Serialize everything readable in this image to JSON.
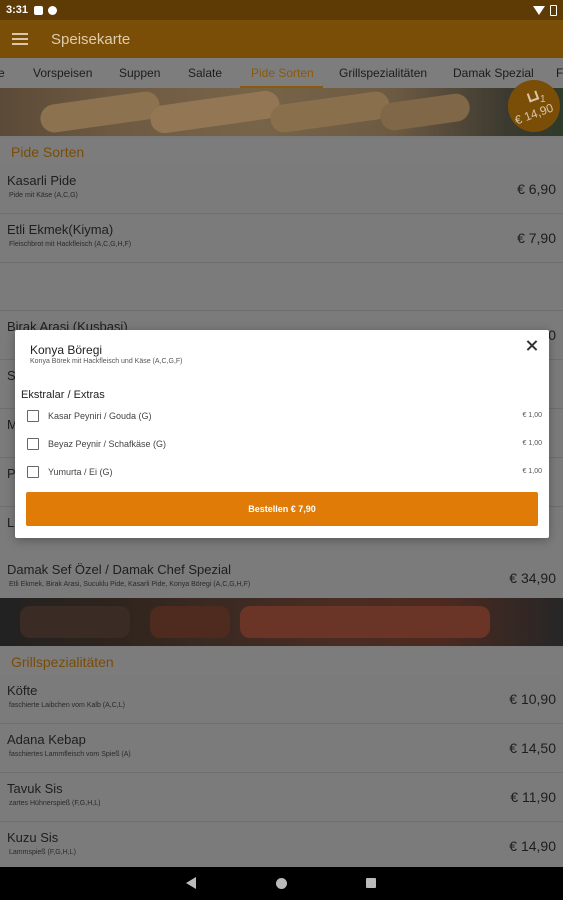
{
  "status_bar": {
    "time": "3:31"
  },
  "app_bar": {
    "title": "Speisekarte"
  },
  "tabs": [
    {
      "label": "e",
      "active": false
    },
    {
      "label": "Vorspeisen",
      "active": false
    },
    {
      "label": "Suppen",
      "active": false
    },
    {
      "label": "Salate",
      "active": false
    },
    {
      "label": "Pide Sorten",
      "active": true
    },
    {
      "label": "Grillspezialitäten",
      "active": false
    },
    {
      "label": "Damak Spezial",
      "active": false
    },
    {
      "label": "F",
      "active": false
    }
  ],
  "cart": {
    "count": "1",
    "total": "€ 14,90"
  },
  "sections": [
    {
      "title": "Pide Sorten",
      "items": [
        {
          "name": "Kasarli Pide",
          "desc": "Pide mit Käse (A,C,G)",
          "price": "€ 6,90"
        },
        {
          "name": "Etli Ekmek(Kiyma)",
          "desc": "Fleischbrot mit Hackfleisch (A,C,G,H,F)",
          "price": "€ 7,90"
        },
        {
          "name": "",
          "desc": "",
          "price": ""
        },
        {
          "name": "Birak Arasi (Kusbasi)",
          "desc": "",
          "price": "€ 7,90"
        },
        {
          "name": "S",
          "desc": "",
          "price": ""
        },
        {
          "name": "M",
          "desc": "",
          "price": ""
        },
        {
          "name": "P",
          "desc": "",
          "price": ""
        },
        {
          "name": "L",
          "desc": "",
          "price": ""
        },
        {
          "name": "Damak Sef Özel / Damak Chef Spezial",
          "desc": "Etli Ekmek, Birak Arasi, Sucuklu Pide, Kasarli Pide, Konya Böregi (A,C,G,H,F)",
          "price": "€ 34,90"
        }
      ]
    },
    {
      "title": "Grillspezialitäten",
      "items": [
        {
          "name": "Köfte",
          "desc": "faschierte Laibchen vom Kalb (A,C,L)",
          "price": "€ 10,90"
        },
        {
          "name": "Adana Kebap",
          "desc": "faschiertes Lammfleisch vom Spieß (A)",
          "price": "€ 14,50"
        },
        {
          "name": "Tavuk Sis",
          "desc": "zartes Hühnerspieß (F,G,H,L)",
          "price": "€ 11,90"
        },
        {
          "name": "Kuzu Sis",
          "desc": "Lammspieß (F,G,H,L)",
          "price": "€ 14,90"
        }
      ]
    }
  ],
  "modal": {
    "title": "Konya Böregi",
    "desc": "Konya Börek mit Hackfleisch und  Käse (A,C,G,F)",
    "extras_heading": "Ekstralar / Extras",
    "extras": [
      {
        "label": "Kasar Peyniri / Gouda (G)",
        "price": "€ 1,00"
      },
      {
        "label": "Beyaz Peynir / Schafkäse (G)",
        "price": "€ 1,00"
      },
      {
        "label": "Yumurta / Ei (G)",
        "price": "€ 1,00"
      }
    ],
    "order_label": "Bestellen € 7,90"
  },
  "colors": {
    "brand": "#7b4e07",
    "accent": "#e07b08"
  },
  "icons": [
    "menu-icon",
    "cart-icon",
    "close-icon",
    "nav-back-icon",
    "nav-home-icon",
    "nav-recent-icon"
  ]
}
